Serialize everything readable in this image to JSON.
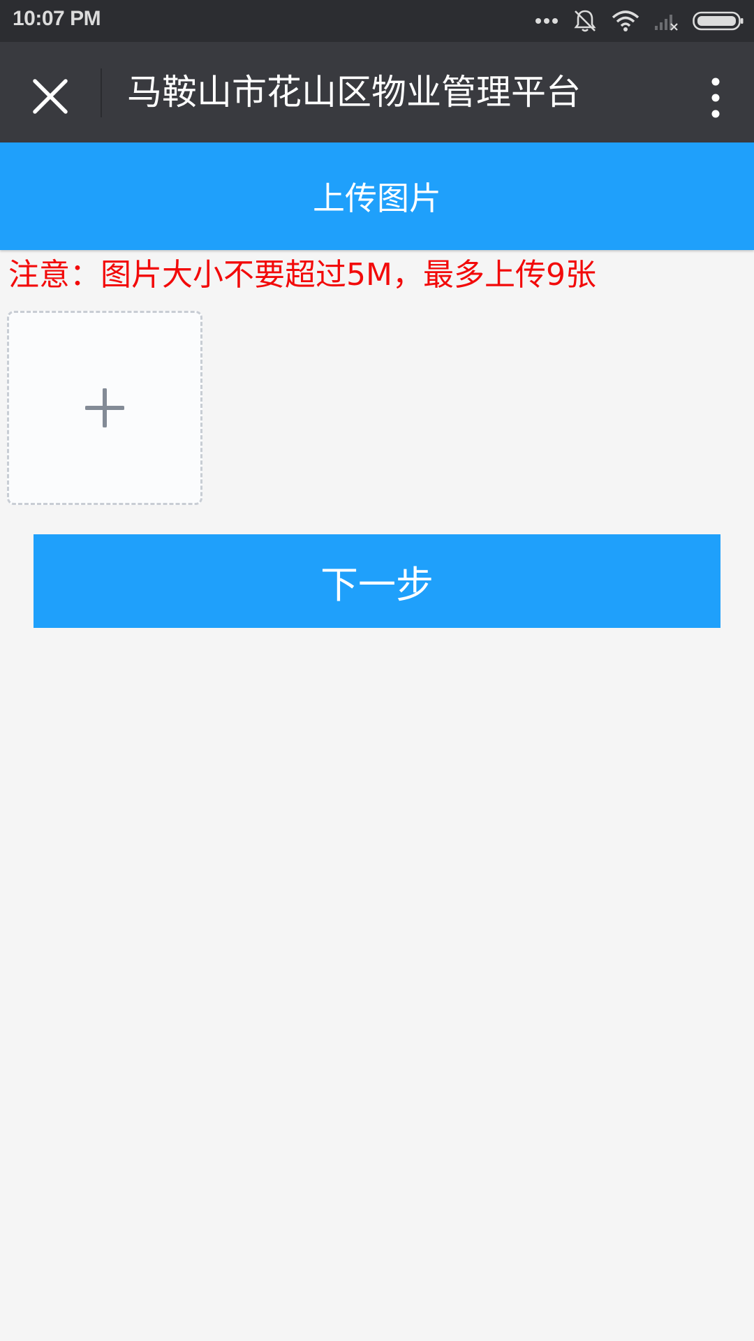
{
  "status_bar": {
    "time": "10:07 PM",
    "icons": [
      "more-dots-icon",
      "bell-muted-icon",
      "wifi-icon",
      "signal-no-service-icon",
      "battery-icon"
    ]
  },
  "title_bar": {
    "close_icon": "close-icon",
    "title": "马鞍山市花山区物业管理平台",
    "more_icon": "more-vertical-icon"
  },
  "upload": {
    "header": "上传图片",
    "notice": "注意：图片大小不要超过5M，最多上传9张",
    "add_icon": "plus-icon"
  },
  "actions": {
    "next_label": "下一步"
  },
  "colors": {
    "status_bar": "#2c2d31",
    "title_bar": "#393a3f",
    "accent_blue": "#1fa0fb",
    "notice_red": "#f20a0a",
    "background": "#f5f5f5"
  }
}
